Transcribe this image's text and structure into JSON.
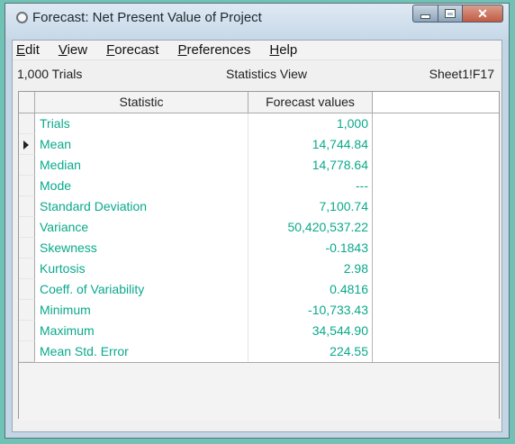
{
  "window": {
    "title": "Forecast: Net Present Value of Project"
  },
  "menu": [
    {
      "label_first": "E",
      "label_rest": "dit"
    },
    {
      "label_first": "V",
      "label_rest": "iew"
    },
    {
      "label_first": "F",
      "label_rest": "orecast"
    },
    {
      "label_first": "P",
      "label_rest": "references"
    },
    {
      "label_first": "H",
      "label_rest": "elp"
    }
  ],
  "info": {
    "trials": "1,000 Trials",
    "view": "Statistics View",
    "cell_ref": "Sheet1!F17"
  },
  "table": {
    "headers": {
      "statistic": "Statistic",
      "values": "Forecast values"
    },
    "rows": [
      {
        "statistic": "Trials",
        "value": "1,000"
      },
      {
        "statistic": "Mean",
        "value": "14,744.84"
      },
      {
        "statistic": "Median",
        "value": "14,778.64"
      },
      {
        "statistic": "Mode",
        "value": "---"
      },
      {
        "statistic": "Standard Deviation",
        "value": "7,100.74"
      },
      {
        "statistic": "Variance",
        "value": "50,420,537.22"
      },
      {
        "statistic": "Skewness",
        "value": "-0.1843"
      },
      {
        "statistic": "Kurtosis",
        "value": "2.98"
      },
      {
        "statistic": "Coeff. of Variability",
        "value": "0.4816"
      },
      {
        "statistic": "Minimum",
        "value": "-10,733.43"
      },
      {
        "statistic": "Maximum",
        "value": "34,544.90"
      },
      {
        "statistic": "Mean Std. Error",
        "value": "224.55"
      }
    ],
    "current_row_index": 1
  },
  "colors": {
    "text_teal": "#0aa98c",
    "background_teal": "#6fc2b4",
    "close_red": "#c25a43"
  }
}
